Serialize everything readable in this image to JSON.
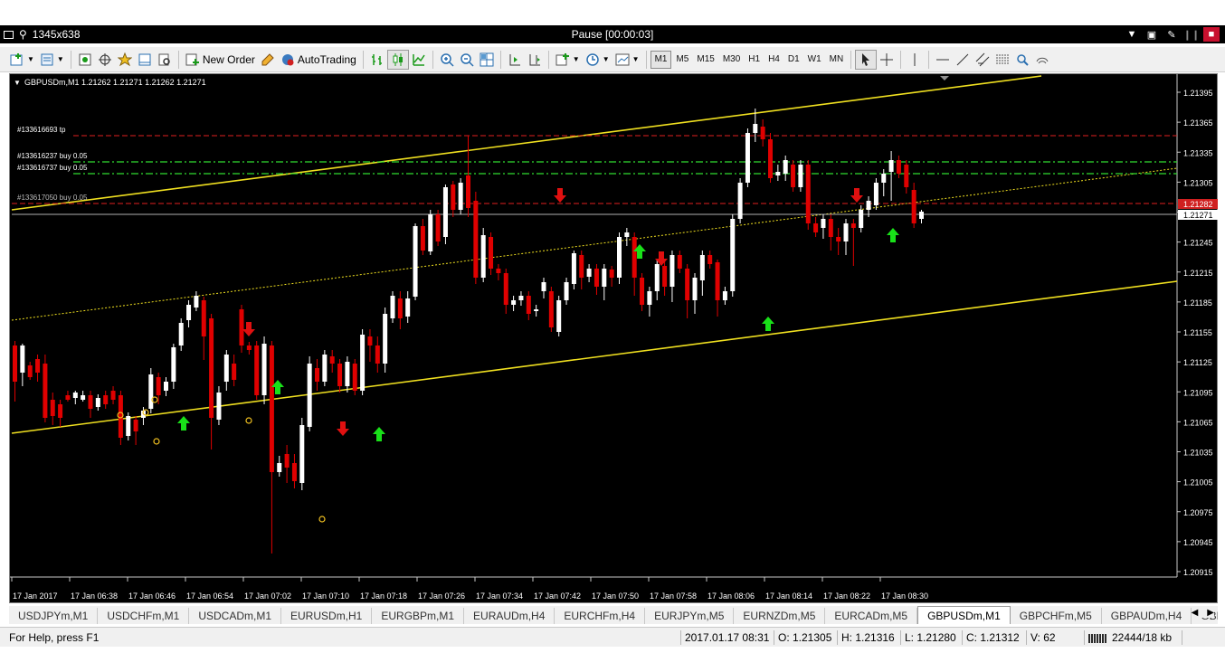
{
  "window": {
    "size_label": "1345x638",
    "title": "Pause [00:00:03]"
  },
  "toolbar": {
    "new_order": "New Order",
    "auto_trading": "AutoTrading",
    "timeframes": [
      "M1",
      "M5",
      "M15",
      "M30",
      "H1",
      "H4",
      "D1",
      "W1",
      "MN"
    ],
    "active_timeframe": "M1"
  },
  "chart": {
    "header": "GBPUSDm,M1  1.21262 1.21271 1.21262 1.21271",
    "price_scale": [
      "1.21395",
      "1.21365",
      "1.21335",
      "1.21305",
      "1.21275",
      "1.21245",
      "1.21215",
      "1.21185",
      "1.21155",
      "1.21125",
      "1.21095",
      "1.21065",
      "1.21035",
      "1.21005",
      "1.20975",
      "1.20945",
      "1.20915"
    ],
    "time_scale": [
      "17 Jan 2017",
      "17 Jan 06:38",
      "17 Jan 06:46",
      "17 Jan 06:54",
      "17 Jan 07:02",
      "17 Jan 07:10",
      "17 Jan 07:18",
      "17 Jan 07:26",
      "17 Jan 07:34",
      "17 Jan 07:42",
      "17 Jan 07:50",
      "17 Jan 07:58",
      "17 Jan 08:06",
      "17 Jan 08:14",
      "17 Jan 08:22",
      "17 Jan 08:30"
    ],
    "bid_label": "1.21271",
    "order_label": "1.21282",
    "order_lines": [
      {
        "text": "#133616693 tp",
        "color": "#ff3030"
      },
      {
        "text": "#133616237 buy 0.05",
        "color": "#33dd33"
      },
      {
        "text": "#133616737 buy 0.05",
        "color": "#33dd33"
      },
      {
        "text": "#133617050 buy 0.05",
        "color": "#ff3030"
      }
    ]
  },
  "tabs": [
    "USDJPYm,M1",
    "USDCHFm,M1",
    "USDCADm,M1",
    "EURUSDm,H1",
    "EURGBPm,M1",
    "EURAUDm,H4",
    "EURCHFm,H4",
    "EURJPYm,M5",
    "EURNZDm,M5",
    "EURCADm,M5",
    "GBPUSDm,M1",
    "GBPCHFm,M5",
    "GBPAUDm,H4",
    "GBP("
  ],
  "active_tab": "GBPUSDm,M1",
  "status": {
    "help": "For Help, press F1",
    "datetime": "2017.01.17 08:31",
    "open": "O: 1.21305",
    "high": "H: 1.21316",
    "low": "L: 1.21280",
    "close": "C: 1.21312",
    "volume": "V: 62",
    "traffic": "22444/18 kb"
  }
}
